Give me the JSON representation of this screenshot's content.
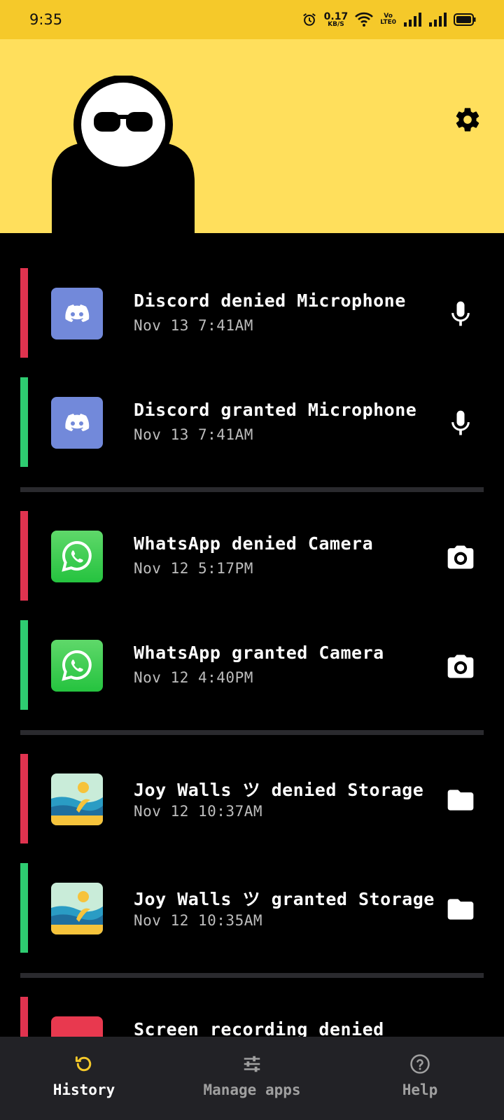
{
  "status_bar": {
    "time": "9:35",
    "net_speed_value": "0.17",
    "net_speed_unit": "KB/S",
    "volte_top": "Vo",
    "volte_bottom": "LTE0"
  },
  "header": {
    "settings_icon": "gear-icon",
    "mascot_icon": "sunglasses-mascot"
  },
  "colors": {
    "status_bar_bg": "#f5c92a",
    "header_bg": "#ffdf5c",
    "denied": "#e0334f",
    "granted": "#2ecc71",
    "active_nav_icon": "#f5c92a"
  },
  "history": [
    {
      "app": "Discord",
      "title": "Discord denied Microphone",
      "time": "Nov 13 7:41AM",
      "status": "denied",
      "permission_icon": "microphone-icon"
    },
    {
      "app": "Discord",
      "title": "Discord granted Microphone",
      "time": "Nov 13 7:41AM",
      "status": "granted",
      "permission_icon": "microphone-icon"
    },
    {
      "app": "WhatsApp",
      "title": "WhatsApp denied Camera",
      "time": "Nov 12 5:17PM",
      "status": "denied",
      "permission_icon": "camera-icon"
    },
    {
      "app": "WhatsApp",
      "title": "WhatsApp granted Camera",
      "time": "Nov 12 4:40PM",
      "status": "granted",
      "permission_icon": "camera-icon"
    },
    {
      "app": "Joy Walls ツ",
      "title": "Joy Walls ツ denied Storage",
      "time": "Nov 12 10:37AM",
      "status": "denied",
      "permission_icon": "folder-icon"
    },
    {
      "app": "Joy Walls ツ",
      "title": "Joy Walls ツ granted Storage",
      "time": "Nov 12 10:35AM",
      "status": "granted",
      "permission_icon": "folder-icon"
    },
    {
      "app": "Screen recording",
      "title": "Screen recording denied",
      "time": "",
      "status": "denied",
      "permission_icon": ""
    }
  ],
  "bottom_nav": [
    {
      "label": "History",
      "icon": "history-icon",
      "active": true
    },
    {
      "label": "Manage apps",
      "icon": "sliders-icon",
      "active": false
    },
    {
      "label": "Help",
      "icon": "help-icon",
      "active": false
    }
  ]
}
